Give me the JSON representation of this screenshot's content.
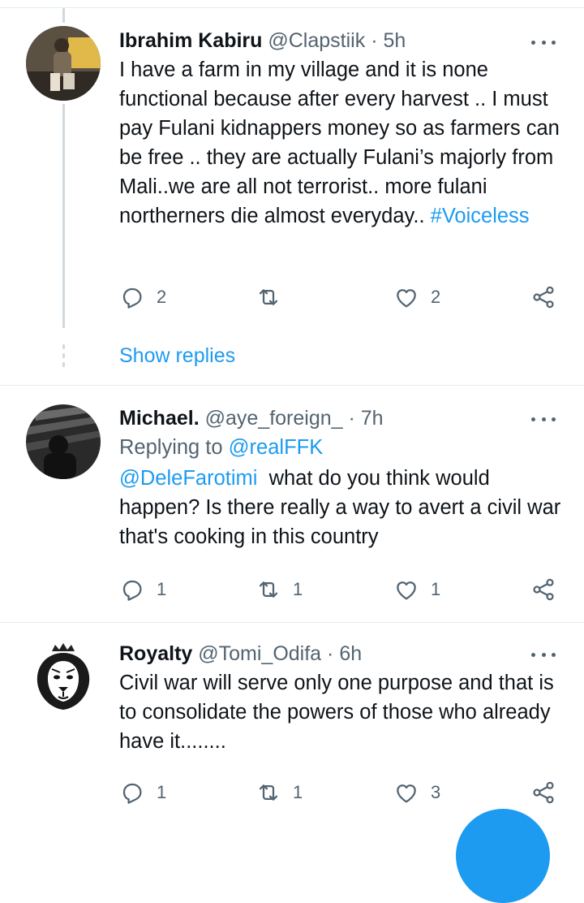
{
  "tweets": [
    {
      "name": "Ibrahim Kabiru",
      "handle": "@Clapstiik",
      "time": "· 5h",
      "text": "I have a farm in my village and it is none functional because after every harvest .. I must pay Fulani kidnappers money so as farmers can be free .. they are actually Fulani’s majorly from Mali..we are all not terrorist.. more fulani northerners die almost everyday..",
      "hashtag": "#Voiceless",
      "replies": "2",
      "retweets": "",
      "likes": "2"
    },
    {
      "name": "Michael.",
      "handle": "@aye_foreign_",
      "time": "· 7h",
      "replying_label": "Replying to",
      "replying_to": "@realFFK",
      "mention": "@DeleFarotimi",
      "text": "  what do you think would happen? Is there really a way to avert a civil war that's cooking in this country",
      "replies": "1",
      "retweets": "1",
      "likes": "1"
    },
    {
      "name": "Royalty",
      "handle": "@Tomi_Odifa",
      "time": "· 6h",
      "text": "Civil war will serve only one purpose and that is to consolidate the powers of those who already have it........",
      "replies": "1",
      "retweets": "1",
      "likes": "3"
    }
  ],
  "show_replies": "Show replies",
  "icons": {
    "reply": "reply-icon",
    "retweet": "retweet-icon",
    "like": "heart-icon",
    "share": "share-icon",
    "more": "more-icon"
  },
  "colors": {
    "accent": "#1d9bf0",
    "secondary_text": "#536471",
    "thread_line": "#cfd9de"
  }
}
